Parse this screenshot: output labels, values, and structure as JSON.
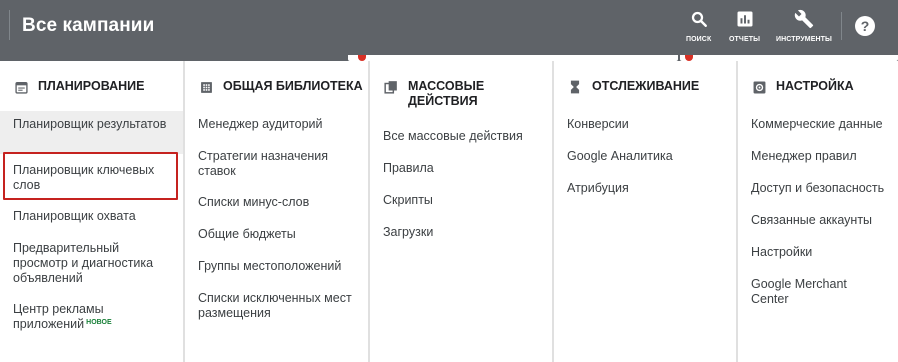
{
  "header": {
    "title": "Все кампании",
    "tools": [
      {
        "label": "поиск",
        "icon": "search-icon"
      },
      {
        "label": "отчеты",
        "icon": "reports-icon"
      },
      {
        "label": "инструменты",
        "icon": "wrench-icon"
      }
    ],
    "help_label": "?"
  },
  "menu": {
    "planning": {
      "heading": "ПЛАНИРОВАНИЕ",
      "icon": "calendar-icon",
      "items": [
        "Планировщик результатов",
        "Планировщик ключевых слов",
        "Планировщик охвата",
        "Предварительный просмотр и диагностика объявлений",
        "Центр рекламы приложений"
      ],
      "new_badge": "НОВОЕ"
    },
    "library": {
      "heading": "ОБЩАЯ БИБЛИОТЕКА",
      "icon": "library-icon",
      "items": [
        "Менеджер аудиторий",
        "Стратегии назначения ставок",
        "Списки минус-слов",
        "Общие бюджеты",
        "Группы местоположений",
        "Списки исключенных мест размещения"
      ]
    },
    "bulk": {
      "heading": "МАССОВЫЕ ДЕЙСТВИЯ",
      "icon": "copy-icon",
      "items": [
        "Все массовые действия",
        "Правила",
        "Скрипты",
        "Загрузки"
      ]
    },
    "tracking": {
      "heading": "ОТСЛЕЖИВАНИЕ",
      "icon": "hourglass-icon",
      "items": [
        "Конверсии",
        "Google Аналитика",
        "Атрибуция"
      ]
    },
    "setup": {
      "heading": "НАСТРОЙКА",
      "icon": "settings-icon",
      "items": [
        "Коммерческие данные",
        "Менеджер правил",
        "Доступ и безопасность",
        "Связанные аккаунты",
        "Настройки",
        "Google Merchant Center"
      ]
    }
  },
  "colors": {
    "topbar": "#5f6368",
    "highlight": "#c5221f",
    "new_badge": "#188038",
    "selected_bg": "#eeeeee"
  }
}
